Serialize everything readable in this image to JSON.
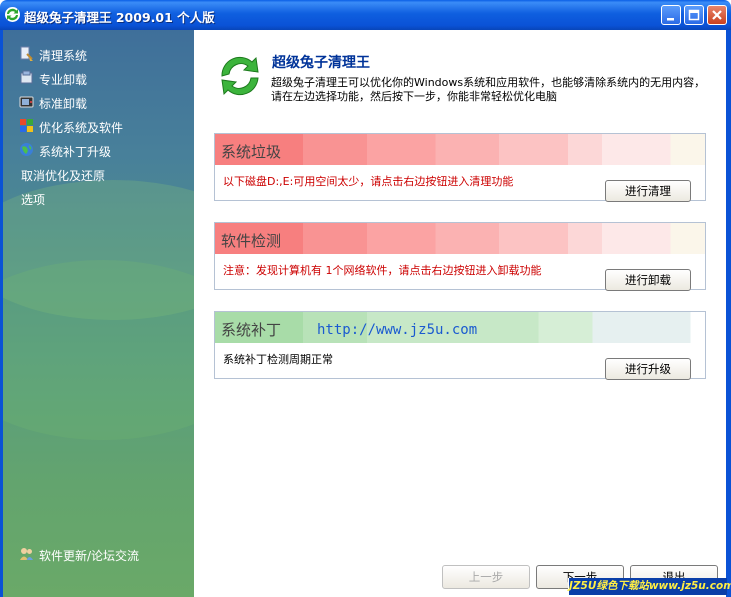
{
  "window": {
    "title": "超级兔子清理王 2009.01 个人版",
    "frame_color": "#0a52d6"
  },
  "sidebar": {
    "items": [
      {
        "label": "清理系统",
        "icon": "broom-icon"
      },
      {
        "label": "专业卸载",
        "icon": "uninstall-icon"
      },
      {
        "label": "标准卸载",
        "icon": "tv-icon"
      },
      {
        "label": "优化系统及软件",
        "icon": "windows-flag-icon"
      },
      {
        "label": "系统补丁升级",
        "icon": "globe-icon"
      },
      {
        "label": "取消优化及还原",
        "icon": ""
      },
      {
        "label": "选项",
        "icon": ""
      }
    ],
    "footer_link": "软件更新/论坛交流",
    "footer_icon": "users-icon"
  },
  "header": {
    "title": "超级兔子清理王",
    "description": "超级兔子清理王可以优化你的Windows系统和应用软件，也能够清除系统内的无用内容，请在左边选择功能，然后按下一步，你能非常轻松优化电脑",
    "logo_icon": "green-refresh-arrows-icon"
  },
  "cards": [
    {
      "title": "系统垃圾",
      "message": "以下磁盘D:,E:可用空间太少，请点击右边按钮进入清理功能",
      "button": "进行清理",
      "band_color": "#f77f7f"
    },
    {
      "title": "软件检测",
      "message": "注意：发现计算机有 1个网络软件，请点击右边按钮进入卸载功能",
      "button": "进行卸载",
      "band_color": "#f77f7f"
    },
    {
      "title": "系统补丁",
      "url": "http://www.jz5u.com",
      "message": "系统补丁检测周期正常",
      "button": "进行升级",
      "band_color": "#a8dca8"
    }
  ],
  "footer": {
    "prev": "上一步",
    "next": "下一步",
    "exit": "退出"
  },
  "watermark": "JZ5U绿色下载站www.jz5u.com"
}
